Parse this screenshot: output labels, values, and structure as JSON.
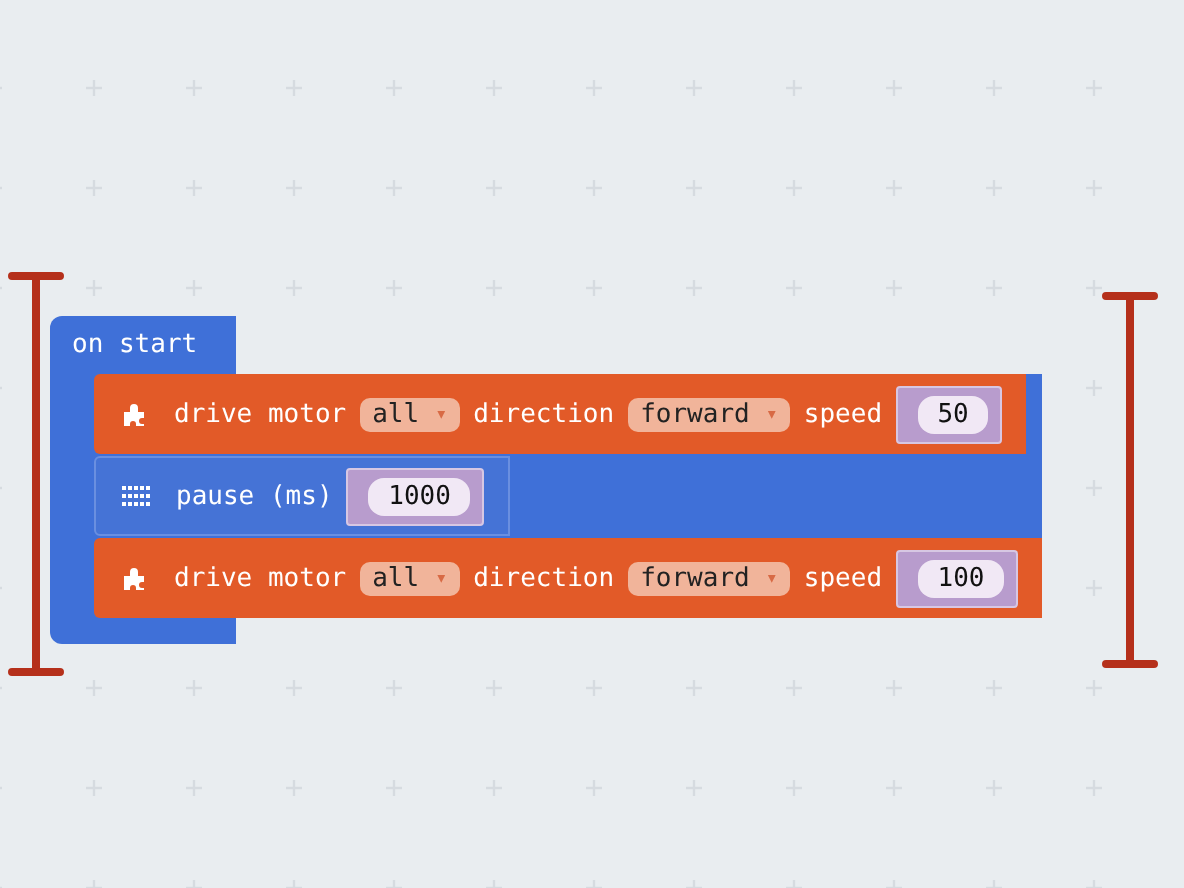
{
  "event_block": {
    "label": "on start",
    "statements": [
      {
        "kind": "motor",
        "parts": [
          {
            "kind": "text",
            "text": "drive motor"
          },
          {
            "kind": "dropdown",
            "value": "all",
            "arrow": "▾"
          },
          {
            "kind": "text",
            "text": "direction"
          },
          {
            "kind": "dropdown",
            "value": "forward",
            "arrow": "▾"
          },
          {
            "kind": "text",
            "text": "speed"
          },
          {
            "kind": "number",
            "value": "50"
          }
        ]
      },
      {
        "kind": "pause",
        "parts": [
          {
            "kind": "text",
            "text": "pause (ms)"
          },
          {
            "kind": "number",
            "value": "1000"
          }
        ]
      },
      {
        "kind": "motor",
        "parts": [
          {
            "kind": "text",
            "text": "drive motor"
          },
          {
            "kind": "dropdown",
            "value": "all",
            "arrow": "▾"
          },
          {
            "kind": "text",
            "text": "direction"
          },
          {
            "kind": "dropdown",
            "value": "forward",
            "arrow": "▾"
          },
          {
            "kind": "text",
            "text": "speed"
          },
          {
            "kind": "number",
            "value": "100"
          }
        ]
      }
    ]
  }
}
